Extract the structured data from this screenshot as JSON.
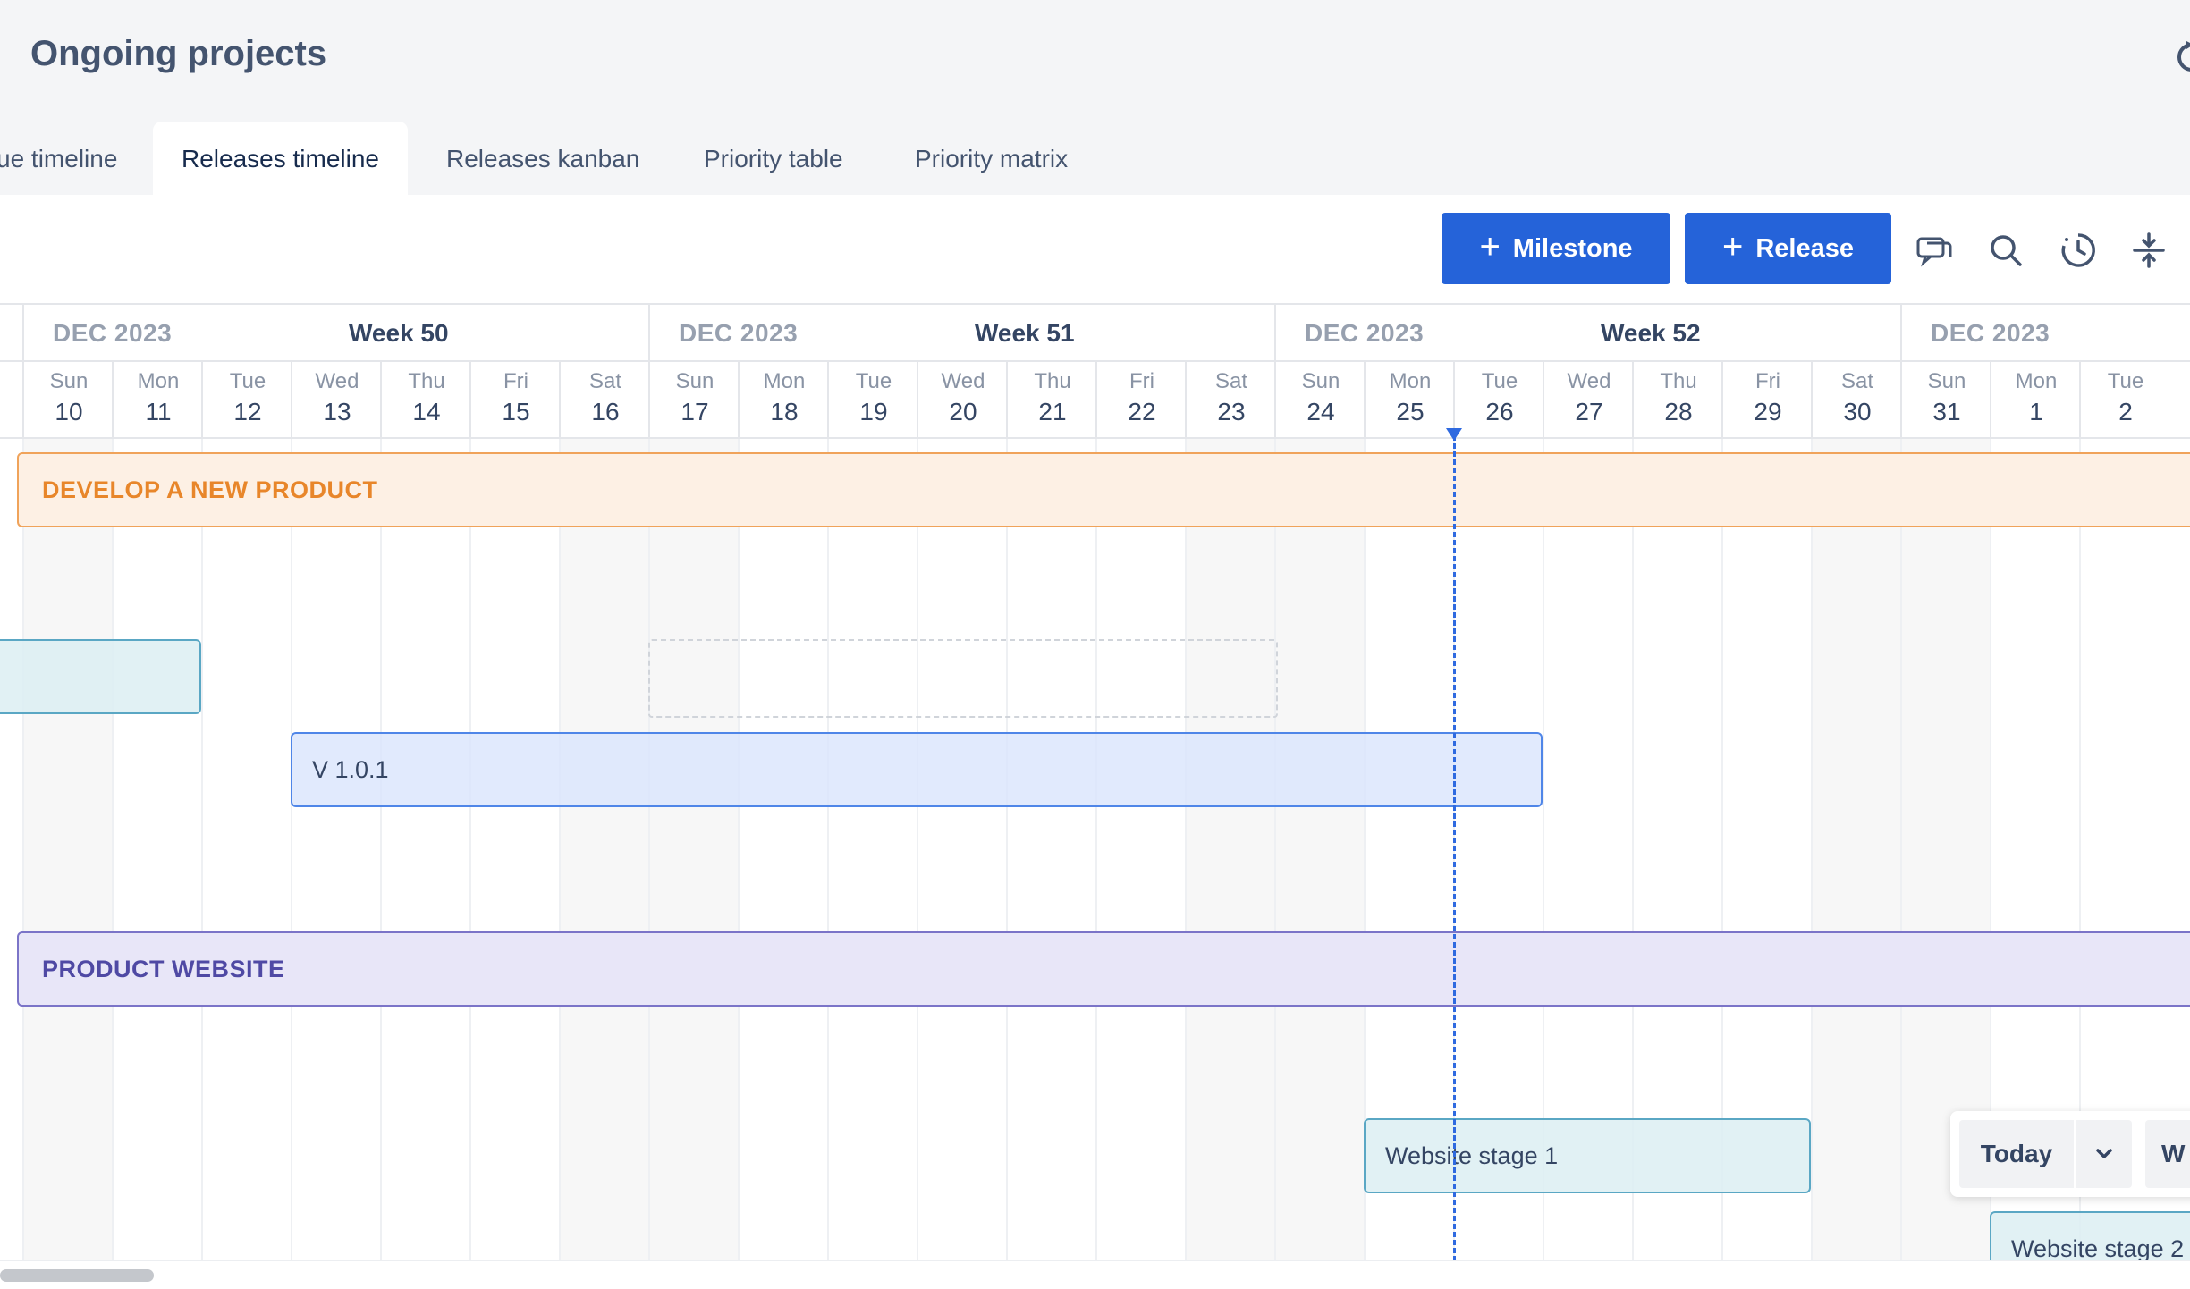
{
  "page": {
    "title": "Ongoing projects"
  },
  "tabs": [
    {
      "label": "ue timeline",
      "active": false
    },
    {
      "label": "Releases timeline",
      "active": true
    },
    {
      "label": "Releases kanban",
      "active": false
    },
    {
      "label": "Priority table",
      "active": false
    },
    {
      "label": "Priority matrix",
      "active": false
    }
  ],
  "toolbar": {
    "milestone_label": "Milestone",
    "release_label": "Release",
    "icons": [
      "comments-icon",
      "search-icon",
      "history-clock-icon",
      "collapse-rows-icon"
    ],
    "accent_color": "#2563d9"
  },
  "timeline": {
    "weeks": [
      {
        "month": "DEC 2023",
        "label": "Week 50"
      },
      {
        "month": "DEC 2023",
        "label": "Week 51"
      },
      {
        "month": "DEC 2023",
        "label": "Week 52"
      },
      {
        "month": "DEC 2023",
        "label": ""
      }
    ],
    "days": [
      {
        "name": "Sun",
        "num": "10"
      },
      {
        "name": "Mon",
        "num": "11"
      },
      {
        "name": "Tue",
        "num": "12"
      },
      {
        "name": "Wed",
        "num": "13"
      },
      {
        "name": "Thu",
        "num": "14"
      },
      {
        "name": "Fri",
        "num": "15"
      },
      {
        "name": "Sat",
        "num": "16"
      },
      {
        "name": "Sun",
        "num": "17"
      },
      {
        "name": "Mon",
        "num": "18"
      },
      {
        "name": "Tue",
        "num": "19"
      },
      {
        "name": "Wed",
        "num": "20"
      },
      {
        "name": "Thu",
        "num": "21"
      },
      {
        "name": "Fri",
        "num": "22"
      },
      {
        "name": "Sat",
        "num": "23"
      },
      {
        "name": "Sun",
        "num": "24"
      },
      {
        "name": "Mon",
        "num": "25"
      },
      {
        "name": "Tue",
        "num": "26"
      },
      {
        "name": "Wed",
        "num": "27"
      },
      {
        "name": "Thu",
        "num": "28"
      },
      {
        "name": "Fri",
        "num": "29"
      },
      {
        "name": "Sat",
        "num": "30"
      },
      {
        "name": "Sun",
        "num": "31"
      },
      {
        "name": "Mon",
        "num": "1"
      },
      {
        "name": "Tue",
        "num": "2"
      }
    ],
    "today": "Tue 26",
    "epics": [
      {
        "name": "DEVELOP A NEW PRODUCT",
        "color": "#e8862a"
      },
      {
        "name": "PRODUCT WEBSITE",
        "color": "#4f49a4"
      }
    ],
    "releases": [
      {
        "name": ""
      },
      {
        "name": "V 1.0.1"
      },
      {
        "name": "Website stage 1"
      },
      {
        "name": "Website stage 2"
      }
    ]
  },
  "today_widget": {
    "today_label": "Today",
    "view_label": "W"
  }
}
